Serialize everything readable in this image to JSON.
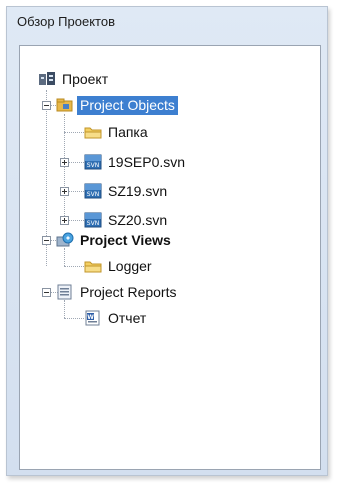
{
  "window": {
    "title": "Обзор Проектов"
  },
  "tree": {
    "root": {
      "label": "Проект",
      "icon": "project-root-icon"
    },
    "project_objects": {
      "label": "Project Objects",
      "icon": "project-objects-icon",
      "selected": true,
      "children": [
        {
          "label": "Папка",
          "icon": "folder-icon"
        },
        {
          "label": "19SEP0.svn",
          "icon": "svn-file-icon"
        },
        {
          "label": "SZ19.svn",
          "icon": "svn-file-icon"
        },
        {
          "label": "SZ20.svn",
          "icon": "svn-file-icon"
        }
      ]
    },
    "project_views": {
      "label": "Project Views",
      "icon": "project-views-icon",
      "children": [
        {
          "label": "Logger",
          "icon": "folder-icon"
        }
      ]
    },
    "project_reports": {
      "label": "Project Reports",
      "icon": "project-reports-icon",
      "children": [
        {
          "label": "Отчет",
          "icon": "report-document-icon"
        }
      ]
    }
  }
}
